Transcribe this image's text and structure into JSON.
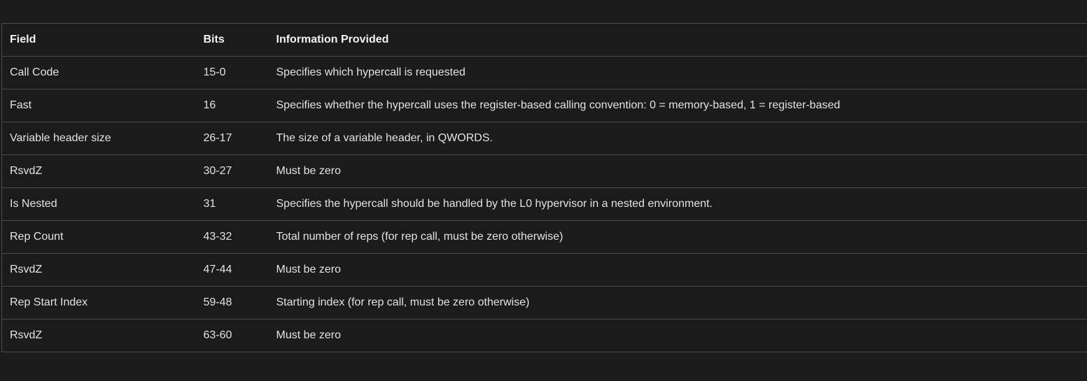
{
  "table": {
    "headers": [
      "Field",
      "Bits",
      "Information Provided"
    ],
    "rows": [
      [
        "Call Code",
        "15-0",
        "Specifies which hypercall is requested"
      ],
      [
        "Fast",
        "16",
        "Specifies whether the hypercall uses the register-based calling convention: 0 = memory-based, 1 = register-based"
      ],
      [
        "Variable header size",
        "26-17",
        "The size of a variable header, in QWORDS."
      ],
      [
        "RsvdZ",
        "30-27",
        "Must be zero"
      ],
      [
        "Is Nested",
        "31",
        "Specifies the hypercall should be handled by the L0 hypervisor in a nested environment."
      ],
      [
        "Rep Count",
        "43-32",
        "Total number of reps (for rep call, must be zero otherwise)"
      ],
      [
        "RsvdZ",
        "47-44",
        "Must be zero"
      ],
      [
        "Rep Start Index",
        "59-48",
        "Starting index (for rep call, must be zero otherwise)"
      ],
      [
        "RsvdZ",
        "63-60",
        "Must be zero"
      ]
    ]
  }
}
